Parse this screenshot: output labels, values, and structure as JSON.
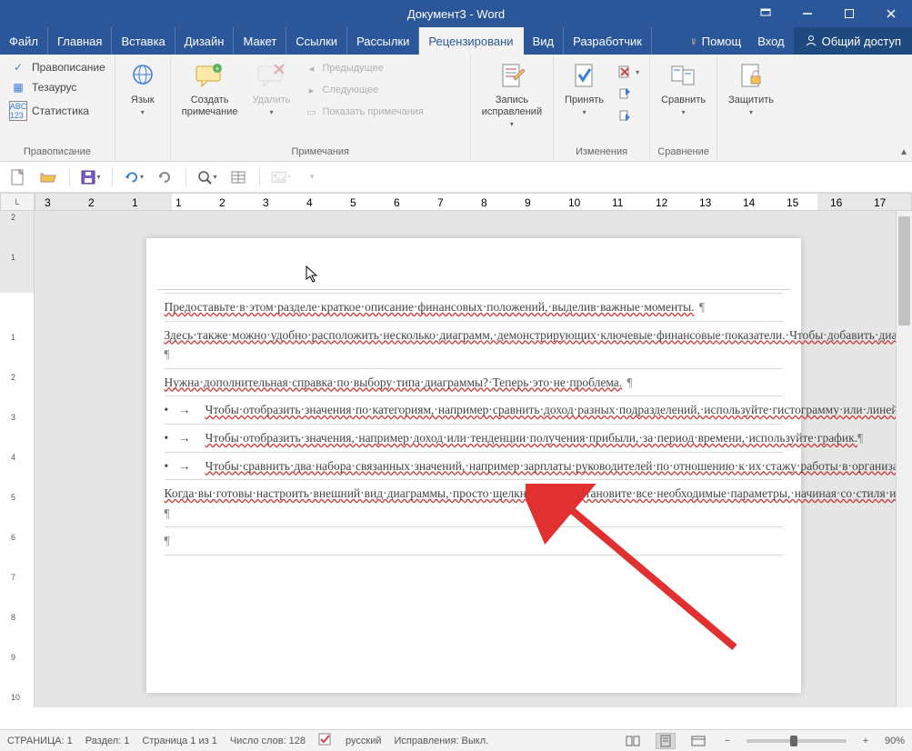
{
  "title": "Документ3 - Word",
  "tabs": {
    "file": "Файл",
    "items": [
      "Главная",
      "Вставка",
      "Дизайн",
      "Макет",
      "Ссылки",
      "Рассылки",
      "Рецензировани",
      "Вид",
      "Разработчик"
    ],
    "activeIndex": 6,
    "help": "Помощ",
    "login": "Вход",
    "share": "Общий доступ"
  },
  "ribbon": {
    "proofing": {
      "spelling": "Правописание",
      "thesaurus": "Тезаурус",
      "stats": "Статистика",
      "label": "Правописание"
    },
    "language": {
      "btn": "Язык"
    },
    "comments": {
      "new": "Создать\nпримечание",
      "delete": "Удалить",
      "prev": "Предыдущее",
      "next": "Следующее",
      "show": "Показать примечания",
      "label": "Примечания"
    },
    "tracking": {
      "track": "Запись\nисправлений",
      "accept": "Принять",
      "compare": "Сравнить",
      "protect": "Защитить",
      "label_changes": "Изменения",
      "label_compare": "Сравнение"
    }
  },
  "document": {
    "p1": "Предоставьте·в·этом·разделе·краткое·описание·финансовых·положений,·выделив·важные·моменты.",
    "p2": "Здесь·также·можно·удобно·расположить·несколько·диаграмм,·демонстрирующих·ключевые·финансовые·показатели.·Чтобы·добавить·диаграмму,·на·вкладке·«Вставка»·выберите·команду·«Диаграмма».·Диаграмма·будет·автоматически·оформлена·в·соответствии·с·видом·отчета.",
    "p3": "Нужна·дополнительная·справка·по·выбору·типа·диаграммы?·Теперь·это·не·проблема.",
    "b1": "Чтобы·отобразить·значения·по·категориям,·например·сравнить·доход·разных·подразделений,·используйте·гистограмму·или·линейчатую·диаграмму.",
    "b2": "Чтобы·отобразить·значения,·например·доход·или·тенденции·получения·прибыли,·за·период·времени,·используйте·график.",
    "b3": "Чтобы·сравнить·два·набора·связанных·значений,·например·зарплаты·руководителей·по·отношению·к·их·стажу·работы·в·организации,·воспользуйтесь·точечной·диаграммой.",
    "p4": "Когда·вы·готовы·настроить·внешний·вид·диаграммы,·просто·щелкните·ее·и·установите·все·необходимые·параметры,·начиная·со·стиля·и·макета·и·заканчивая·управлением·данных,·с·помощью·значков·справа."
  },
  "status": {
    "page": "СТРАНИЦА: 1",
    "section": "Раздел: 1",
    "pageOf": "Страница 1 из 1",
    "words": "Число слов: 128",
    "lang": "русский",
    "track": "Исправления: Выкл.",
    "zoom": "90%"
  },
  "ruler": {
    "h": [
      "3",
      "2",
      "1",
      "1",
      "2",
      "3",
      "4",
      "5",
      "6",
      "7",
      "8",
      "9",
      "10",
      "11",
      "12",
      "13",
      "14",
      "15",
      "16",
      "17"
    ]
  }
}
